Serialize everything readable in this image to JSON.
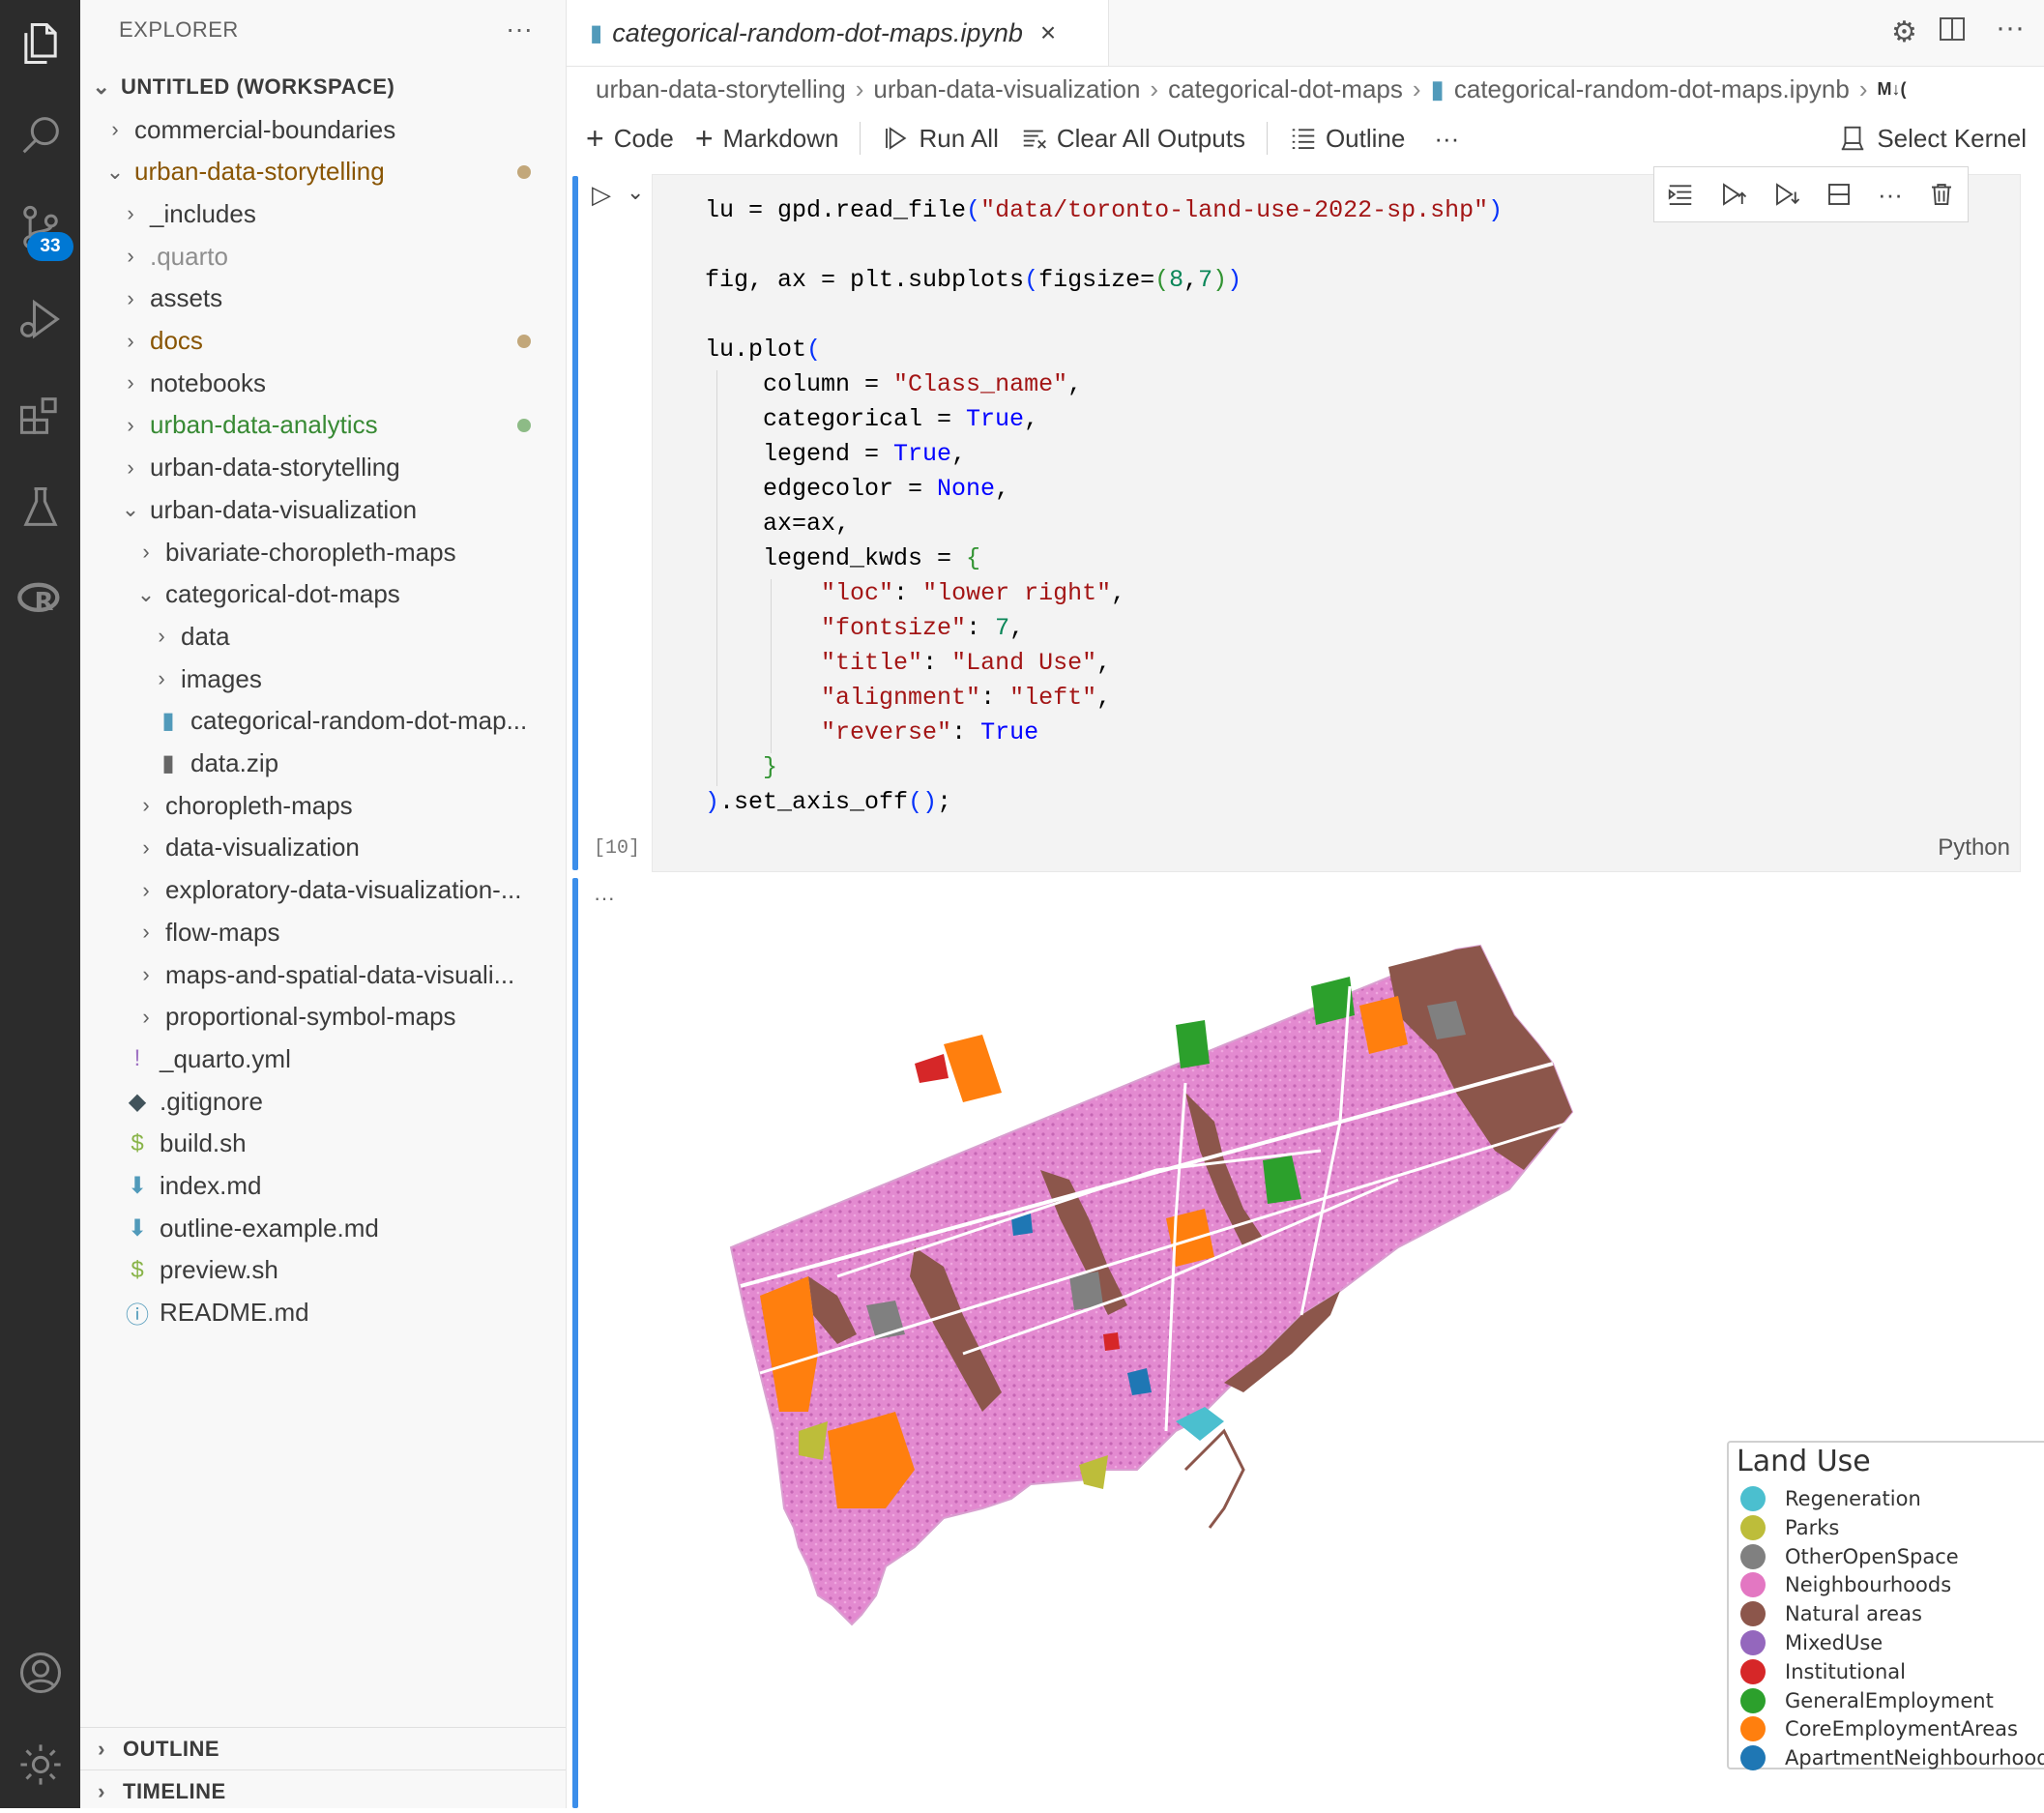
{
  "activity_bar": {
    "scm_badge": "33",
    "items": [
      "explorer-icon",
      "search-icon",
      "source-control-icon",
      "run-debug-icon",
      "extensions-icon",
      "testing-icon",
      "r-icon"
    ],
    "bottom": [
      "account-icon",
      "settings-gear-icon"
    ]
  },
  "explorer": {
    "header": "EXPLORER",
    "workspace": "UNTITLED (WORKSPACE)",
    "items": [
      {
        "label": "commercial-boundaries",
        "color": "#3b3b3b",
        "indent": 0,
        "chev": "right"
      },
      {
        "label": "urban-data-storytelling",
        "color": "#895503",
        "indent": 0,
        "chev": "down",
        "dot": "#c2a77a"
      },
      {
        "label": "_includes",
        "color": "#3b3b3b",
        "indent": 1,
        "chev": "right"
      },
      {
        "label": ".quarto",
        "color": "#8e8e8e",
        "indent": 1,
        "chev": "right"
      },
      {
        "label": "assets",
        "color": "#3b3b3b",
        "indent": 1,
        "chev": "right"
      },
      {
        "label": "docs",
        "color": "#895503",
        "indent": 1,
        "chev": "right",
        "dot": "#c2a77a"
      },
      {
        "label": "notebooks",
        "color": "#3b3b3b",
        "indent": 1,
        "chev": "right"
      },
      {
        "label": "urban-data-analytics",
        "color": "#388a34",
        "indent": 1,
        "chev": "right",
        "dot": "#8dbb86"
      },
      {
        "label": "urban-data-storytelling",
        "color": "#3b3b3b",
        "indent": 1,
        "chev": "right"
      },
      {
        "label": "urban-data-visualization",
        "color": "#3b3b3b",
        "indent": 1,
        "chev": "down"
      },
      {
        "label": "bivariate-choropleth-maps",
        "color": "#3b3b3b",
        "indent": 2,
        "chev": "right"
      },
      {
        "label": "categorical-dot-maps",
        "color": "#3b3b3b",
        "indent": 2,
        "chev": "down"
      },
      {
        "label": "data",
        "color": "#3b3b3b",
        "indent": 3,
        "chev": "right"
      },
      {
        "label": "images",
        "color": "#3b3b3b",
        "indent": 3,
        "chev": "right"
      },
      {
        "label": "categorical-random-dot-map...",
        "color": "#3b3b3b",
        "indent": 3,
        "icon": "notebook"
      },
      {
        "label": "data.zip",
        "color": "#3b3b3b",
        "indent": 3,
        "icon": "zip"
      },
      {
        "label": "choropleth-maps",
        "color": "#3b3b3b",
        "indent": 2,
        "chev": "right"
      },
      {
        "label": "data-visualization",
        "color": "#3b3b3b",
        "indent": 2,
        "chev": "right"
      },
      {
        "label": "exploratory-data-visualization-...",
        "color": "#3b3b3b",
        "indent": 2,
        "chev": "right"
      },
      {
        "label": "flow-maps",
        "color": "#3b3b3b",
        "indent": 2,
        "chev": "right"
      },
      {
        "label": "maps-and-spatial-data-visuali...",
        "color": "#3b3b3b",
        "indent": 2,
        "chev": "right"
      },
      {
        "label": "proportional-symbol-maps",
        "color": "#3b3b3b",
        "indent": 2,
        "chev": "right"
      },
      {
        "label": "_quarto.yml",
        "color": "#3b3b3b",
        "indent": 1,
        "icon": "yaml"
      },
      {
        "label": ".gitignore",
        "color": "#3b3b3b",
        "indent": 1,
        "icon": "git"
      },
      {
        "label": "build.sh",
        "color": "#3b3b3b",
        "indent": 1,
        "icon": "shell"
      },
      {
        "label": "index.md",
        "color": "#3b3b3b",
        "indent": 1,
        "icon": "markdown"
      },
      {
        "label": "outline-example.md",
        "color": "#3b3b3b",
        "indent": 1,
        "icon": "markdown"
      },
      {
        "label": "preview.sh",
        "color": "#3b3b3b",
        "indent": 1,
        "icon": "shell"
      },
      {
        "label": "README.md",
        "color": "#3b3b3b",
        "indent": 1,
        "icon": "info"
      }
    ],
    "outline": "OUTLINE",
    "timeline": "TIMELINE"
  },
  "tab": {
    "title": "categorical-random-dot-maps.ipynb"
  },
  "breadcrumb": [
    "urban-data-storytelling",
    "urban-data-visualization",
    "categorical-dot-maps",
    "categorical-random-dot-maps.ipynb"
  ],
  "breadcrumb_tail": "M↓(",
  "toolbar": {
    "code": "Code",
    "markdown": "Markdown",
    "run_all": "Run All",
    "clear": "Clear All Outputs",
    "outline": "Outline",
    "more": "···",
    "kernel": "Select Kernel"
  },
  "cell": {
    "exec_count": "[10]",
    "language": "Python",
    "output_dots": "···"
  },
  "legend": {
    "title": "Land Use",
    "items": [
      {
        "label": "Regeneration",
        "color": "#4bbfcf"
      },
      {
        "label": "Parks",
        "color": "#bdbd3a"
      },
      {
        "label": "OtherOpenSpace",
        "color": "#808080"
      },
      {
        "label": "Neighbourhoods",
        "color": "#e377c2"
      },
      {
        "label": "Natural areas",
        "color": "#8c564b"
      },
      {
        "label": "MixedUse",
        "color": "#9467bd"
      },
      {
        "label": "Institutional",
        "color": "#d62728"
      },
      {
        "label": "GeneralEmployment",
        "color": "#2ca02c"
      },
      {
        "label": "CoreEmploymentAreas",
        "color": "#ff7f0e"
      },
      {
        "label": "ApartmentNeighbourhoods",
        "color": "#1f77b4"
      }
    ]
  }
}
